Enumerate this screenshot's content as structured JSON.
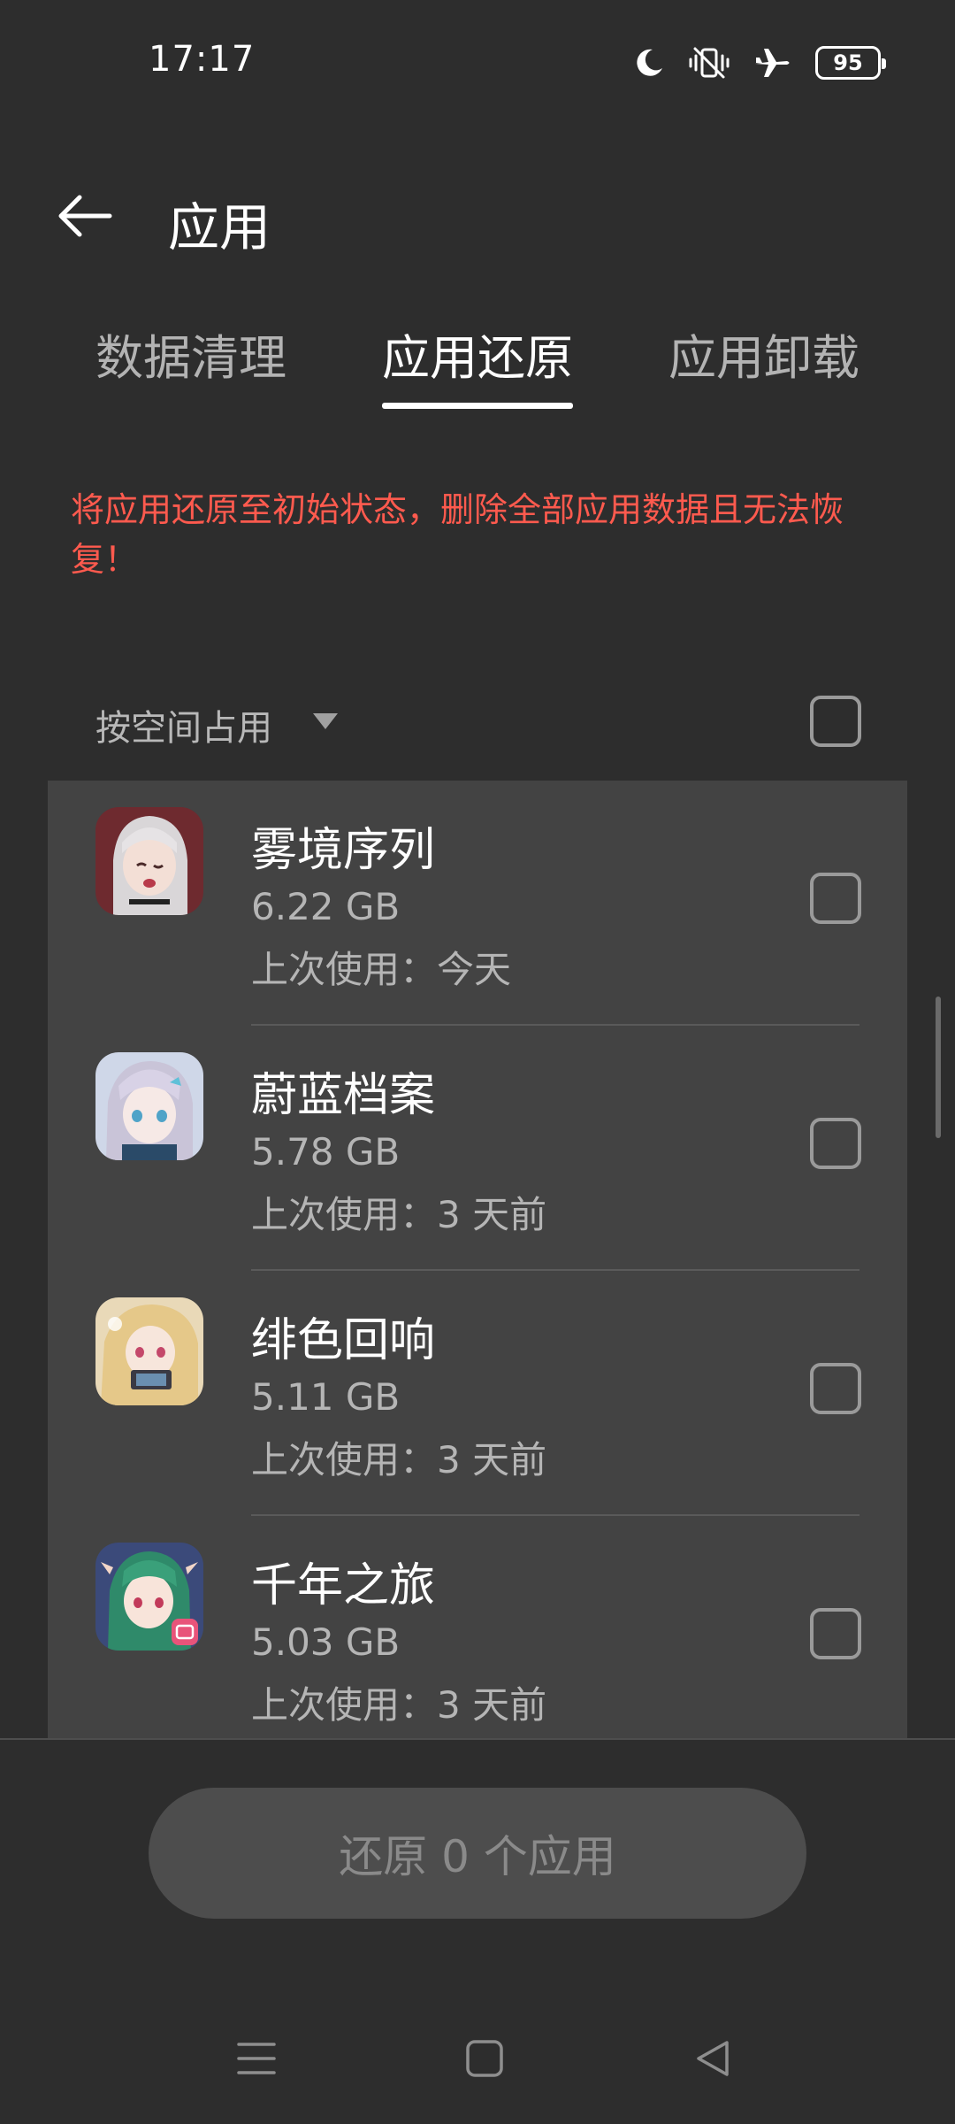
{
  "status_bar": {
    "time": "17:17",
    "battery": "95",
    "icons": [
      "moon-icon",
      "vibrate-off-icon",
      "airplane-icon",
      "battery-icon"
    ]
  },
  "header": {
    "title": "应用"
  },
  "tabs": [
    {
      "label": "数据清理",
      "active": false
    },
    {
      "label": "应用还原",
      "active": true
    },
    {
      "label": "应用卸载",
      "active": false
    }
  ],
  "warning": "将应用还原至初始状态，删除全部应用数据且无法恢复！",
  "sort": {
    "label": "按空间占用"
  },
  "apps": [
    {
      "name": "雾境序列",
      "size": "6.22 GB",
      "last_used": "上次使用：今天"
    },
    {
      "name": "蔚蓝档案",
      "size": "5.78 GB",
      "last_used": "上次使用：3 天前"
    },
    {
      "name": "绯色回响",
      "size": "5.11 GB",
      "last_used": "上次使用：3 天前"
    },
    {
      "name": "千年之旅",
      "size": "5.03 GB",
      "last_used": "上次使用：3 天前"
    }
  ],
  "action": {
    "restore_label": "还原 0 个应用"
  },
  "colors": {
    "background": "#2d2d2d",
    "panel": "#434343",
    "warning": "#ff5a4e"
  }
}
